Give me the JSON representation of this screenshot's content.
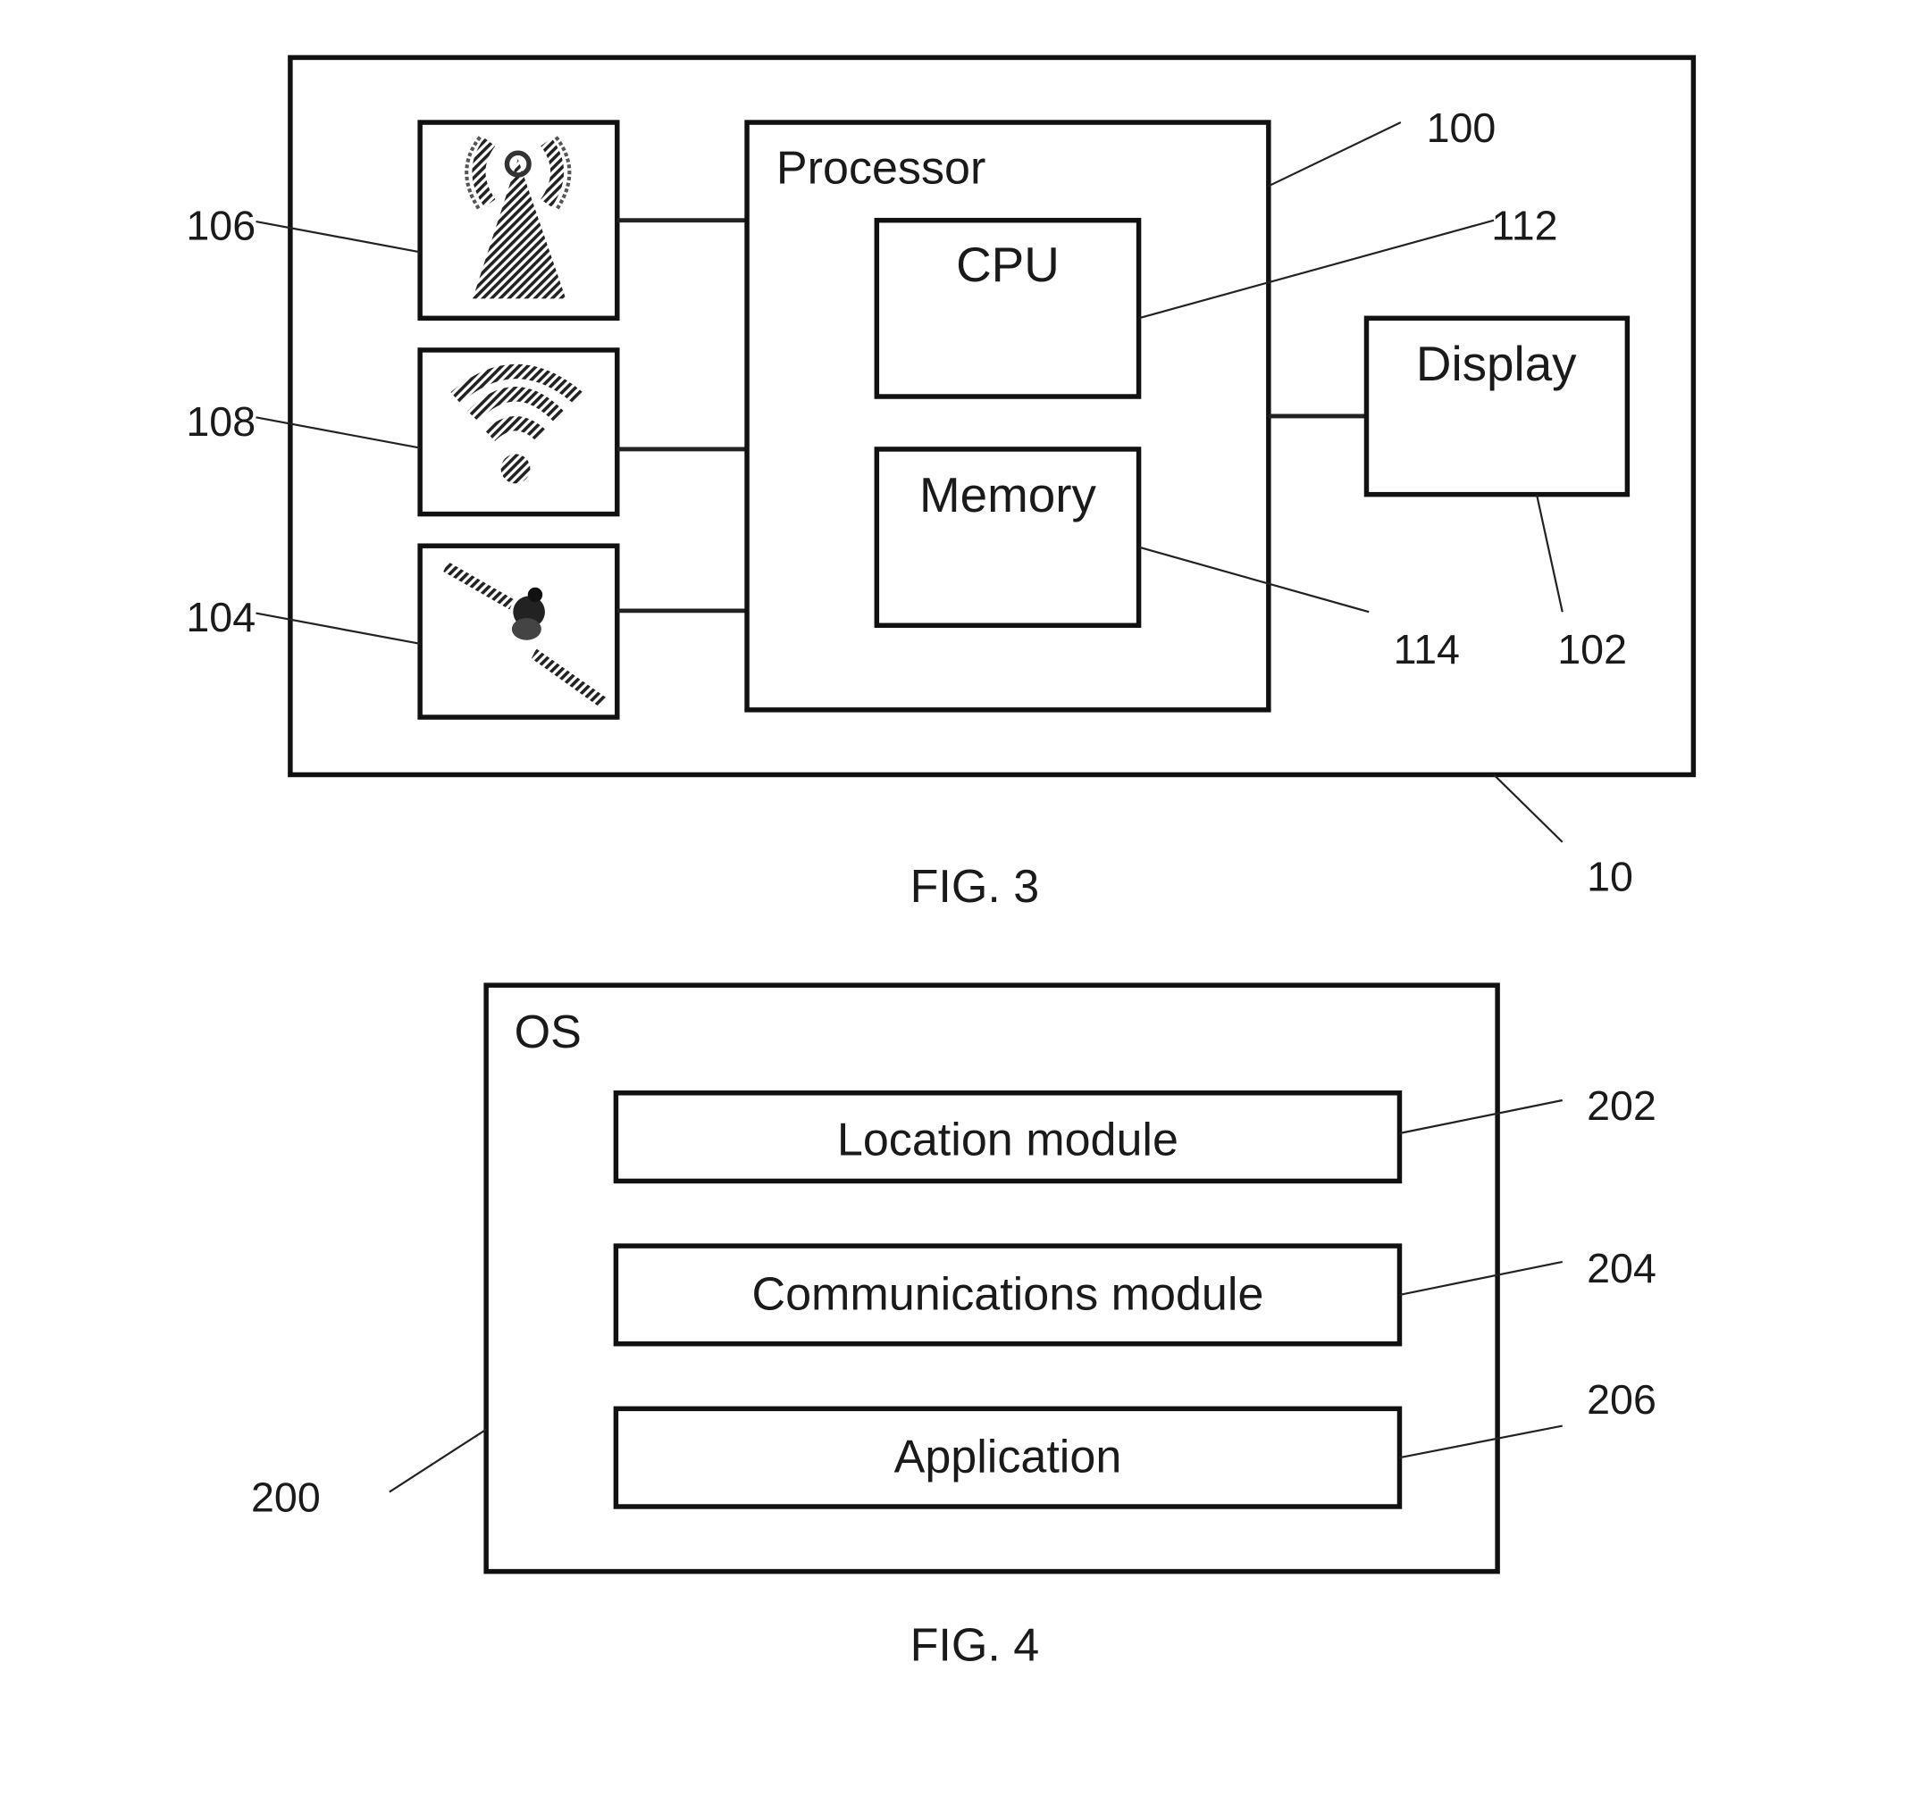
{
  "fig3": {
    "caption": "FIG. 3",
    "device_ref": "10",
    "processor": {
      "label": "Processor",
      "ref": "100"
    },
    "cpu": {
      "label": "CPU",
      "ref": "112"
    },
    "memory": {
      "label": "Memory",
      "ref": "114"
    },
    "display": {
      "label": "Display",
      "ref": "102"
    },
    "icons": [
      {
        "name": "cell-tower-icon",
        "ref": "106"
      },
      {
        "name": "wifi-icon",
        "ref": "108"
      },
      {
        "name": "satellite-icon",
        "ref": "104"
      }
    ]
  },
  "fig4": {
    "caption": "FIG. 4",
    "os": {
      "label": "OS",
      "ref": "200"
    },
    "modules": [
      {
        "label": "Location module",
        "ref": "202"
      },
      {
        "label": "Communications module",
        "ref": "204"
      },
      {
        "label": "Application",
        "ref": "206"
      }
    ]
  }
}
